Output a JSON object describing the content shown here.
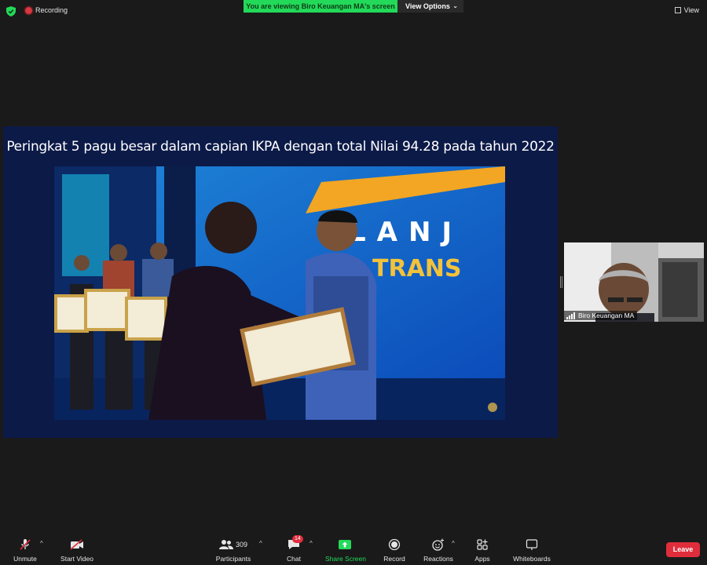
{
  "topbar": {
    "recording_label": "Recording",
    "banner_text": "You are viewing Biro Keuangan MA's screen",
    "view_options_label": "View Options",
    "view_label": "View"
  },
  "shared_screen": {
    "slide_title": "Peringkat 5 pagu besar dalam capian IKPA  dengan total Nilai 94.28 pada tahun 2022",
    "background_text_1": "LANJ",
    "background_text_2": "TRANS"
  },
  "participant_thumb": {
    "name": "Biro Keuangan MA"
  },
  "toolbar": {
    "unmute": "Unmute",
    "start_video": "Start Video",
    "participants": "Participants",
    "participants_count": "309",
    "chat": "Chat",
    "chat_badge": "14",
    "share_screen": "Share Screen",
    "record": "Record",
    "reactions": "Reactions",
    "apps": "Apps",
    "whiteboards": "Whiteboards",
    "leave": "Leave"
  },
  "colors": {
    "accent_green": "#23d959",
    "leave_red": "#e02d3c",
    "background": "#1a1a1a"
  }
}
